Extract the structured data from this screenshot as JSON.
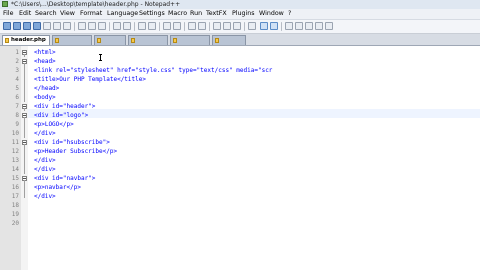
{
  "window": {
    "title": "*C:\\Users\\...\\Desktop\\template\\header.php - Notepad++"
  },
  "menu": [
    "File",
    "Edit",
    "Search",
    "View",
    "Format",
    "Language",
    "Settings",
    "Macro",
    "Run",
    "TextFX",
    "Plugins",
    "Window",
    "?"
  ],
  "tabs": [
    {
      "label": "header.php",
      "active": true
    },
    {
      "label": "",
      "active": false
    },
    {
      "label": "",
      "active": false
    },
    {
      "label": "",
      "active": false
    },
    {
      "label": "",
      "active": false
    },
    {
      "label": "",
      "active": false
    }
  ],
  "editor": {
    "lines": [
      {
        "n": "1",
        "text": "<html>"
      },
      {
        "n": "2",
        "text": "<head>"
      },
      {
        "n": "3",
        "text": "<link rel=\"stylesheet\" href=\"style.css\" type=\"text/css\" media=\"scr"
      },
      {
        "n": "4",
        "text": "<title>Our PHP Template</title>"
      },
      {
        "n": "5",
        "text": "</head>"
      },
      {
        "n": "6",
        "text": "<body>"
      },
      {
        "n": "7",
        "text": "<div id=\"header\">"
      },
      {
        "n": "8",
        "text": "<div id=\"logo\">"
      },
      {
        "n": "9",
        "text": "<p>LOGO</p>"
      },
      {
        "n": "10",
        "text": "</div>"
      },
      {
        "n": "11",
        "text": "<div id=\"hsubscribe\">"
      },
      {
        "n": "12",
        "text": "<p>Header Subscribe</p>"
      },
      {
        "n": "13",
        "text": "</div>"
      },
      {
        "n": "14",
        "text": "</div>"
      },
      {
        "n": "15",
        "text": "<div id=\"navbar\">"
      },
      {
        "n": "16",
        "text": "<p>navbar</p>"
      },
      {
        "n": "17",
        "text": "</div>"
      },
      {
        "n": "18",
        "text": ""
      },
      {
        "n": "19",
        "text": ""
      },
      {
        "n": "20",
        "text": ""
      }
    ]
  }
}
